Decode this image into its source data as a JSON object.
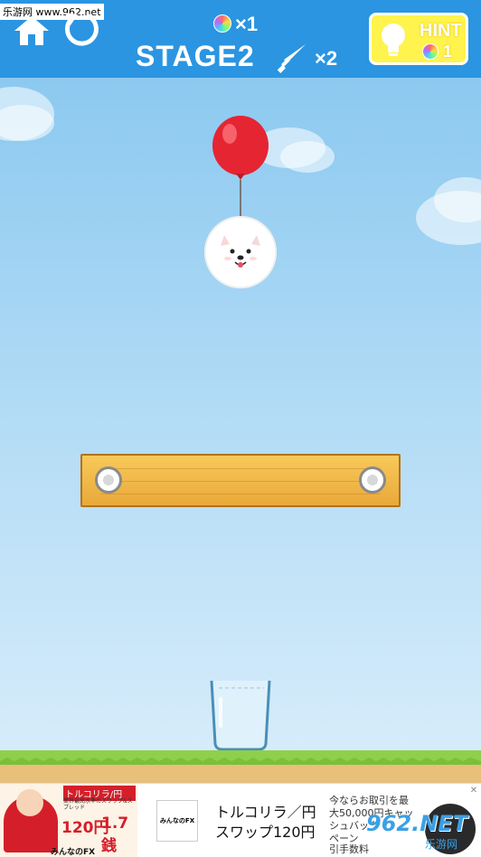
{
  "watermark": "乐游网 www.962.net",
  "header": {
    "stage_label": "STAGE2",
    "orb_count": "×1",
    "knife_count": "×2",
    "hint_label": "HINT",
    "hint_count": "1"
  },
  "colors": {
    "topbar": "#2b95e1",
    "hint_bg": "#fff34d",
    "balloon": "#e52532",
    "ground": "#8fd04a"
  },
  "ad": {
    "left_title": "トルコリラ/円",
    "left_sub": "業界最高水準のスワップ&スプレッド",
    "left_rate1": "120円",
    "left_rate2": "1.7銭",
    "left_brand": "みんなのFX",
    "logo_text": "みんなのFX",
    "center_line1": "トルコリラ／円",
    "center_line2": "スワップ120円",
    "right_line1": "今ならお取引を最",
    "right_line2": "大50,000円キャッ",
    "right_line3": "シュバック",
    "right_line4": "ペーン",
    "right_line5": "引手数料",
    "corner_mark": "962.NET",
    "corner_sub": "乐游网"
  }
}
